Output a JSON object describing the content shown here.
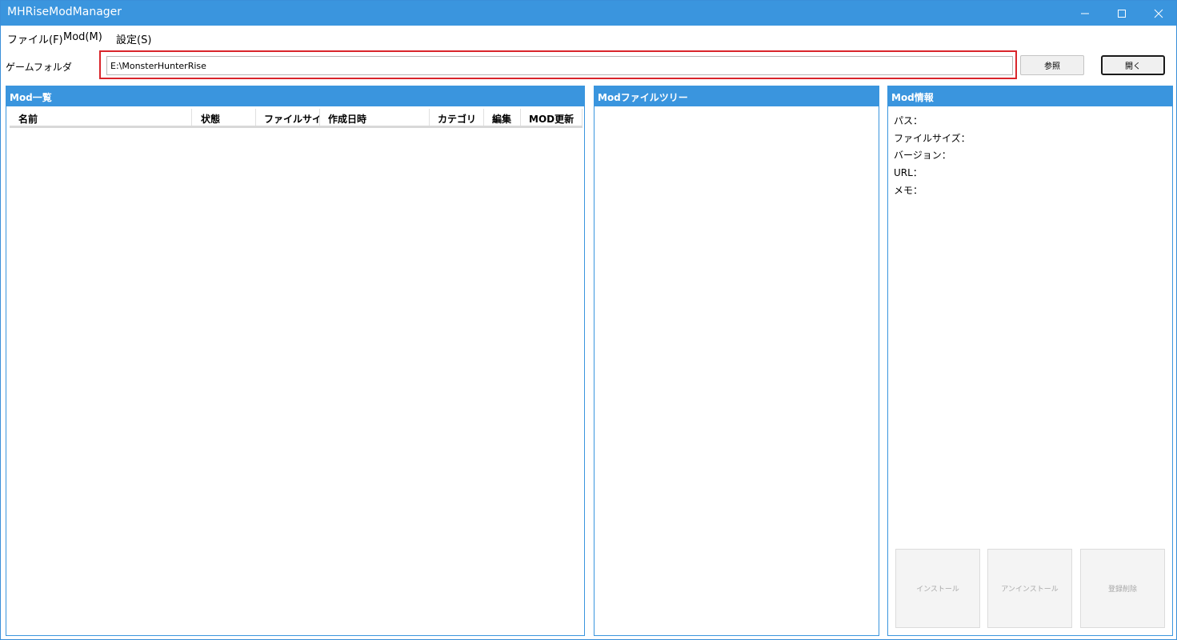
{
  "window": {
    "title": "MHRiseModManager"
  },
  "menu": {
    "file": "ファイル(F)",
    "mod": "Mod(M)",
    "settings": "設定(S)"
  },
  "folder": {
    "label": "ゲームフォルダ",
    "value": "E:\\MonsterHunterRise",
    "browse_label": "参照",
    "open_label": "開く"
  },
  "mod_list": {
    "header": "Mod一覧",
    "columns": [
      "名前",
      "状態",
      "ファイルサイズ",
      "作成日時",
      "カテゴリ",
      "編集",
      "MOD更新"
    ],
    "rows": []
  },
  "file_tree": {
    "header": "Modファイルツリー"
  },
  "mod_info": {
    "header": "Mod情報",
    "path_label": "パス：",
    "filesize_label": "ファイルサイズ：",
    "version_label": "バージョン：",
    "url_label": "URL：",
    "memo_label": "メモ：",
    "install_label": "インストール",
    "uninstall_label": "アンインストール",
    "unregister_label": "登録削除"
  },
  "colors": {
    "accent": "#3a95de",
    "highlight_border": "#d9252b",
    "disabled_text": "#a8a8a8"
  }
}
